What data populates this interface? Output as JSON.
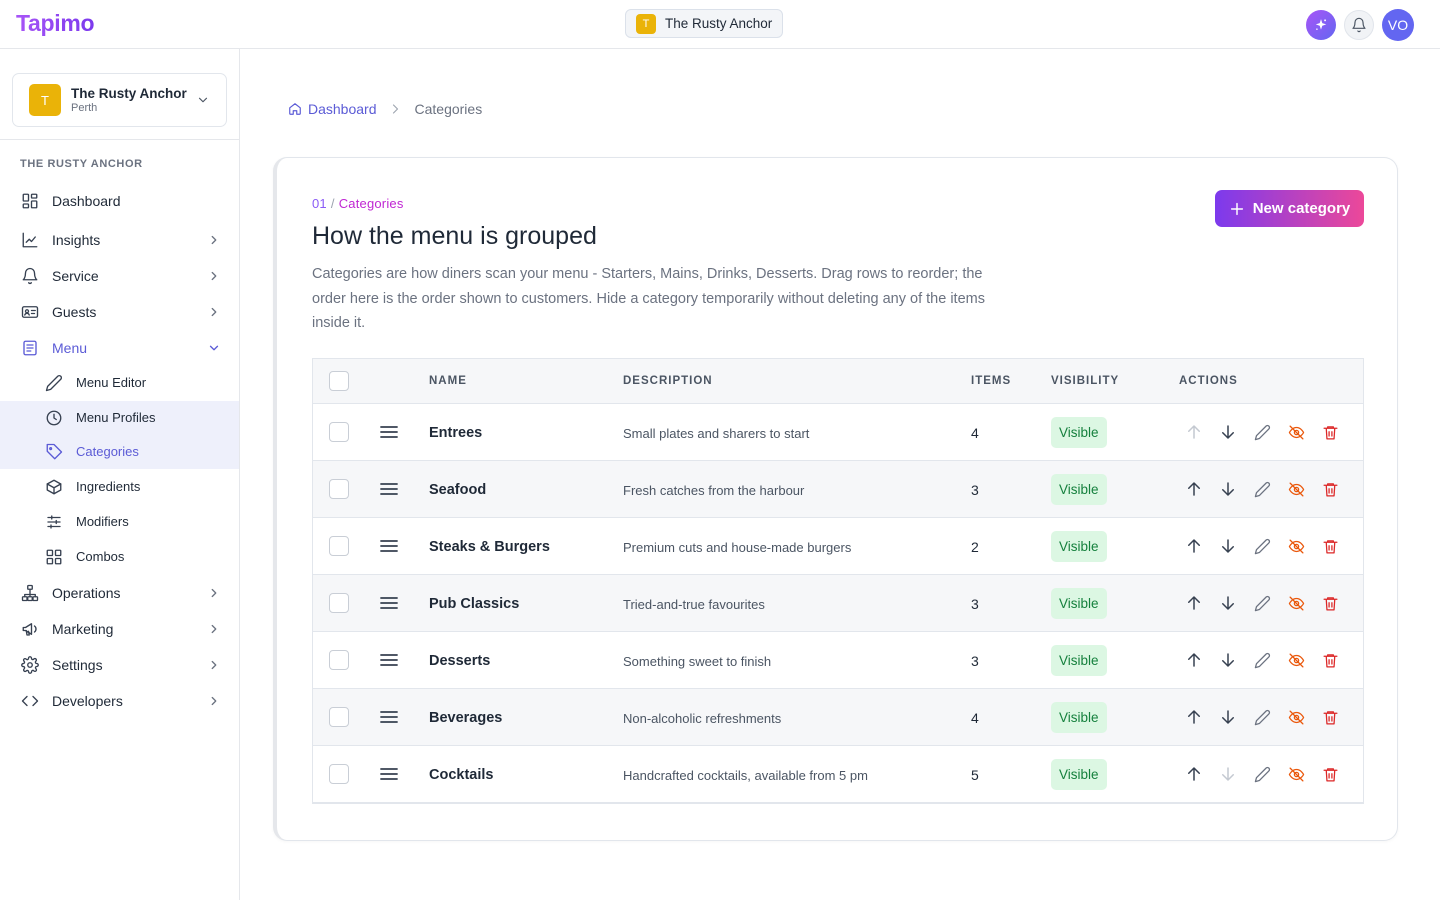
{
  "brand": {
    "logo_text": "Tapimo"
  },
  "topbar": {
    "venue_initial": "T",
    "venue_name": "The Rusty Anchor",
    "avatar_initials": "VO"
  },
  "sidebar": {
    "venue_initial": "T",
    "venue_name": "The Rusty Anchor",
    "venue_city": "Perth",
    "section_title": "THE RUSTY ANCHOR",
    "items": [
      {
        "label": "Dashboard",
        "icon": "grid-icon"
      },
      {
        "label": "Insights",
        "icon": "chart-icon"
      },
      {
        "label": "Service",
        "icon": "bell-icon"
      },
      {
        "label": "Guests",
        "icon": "id-card-icon"
      },
      {
        "label": "Menu",
        "icon": "book-icon"
      },
      {
        "label": "Operations",
        "icon": "org-icon"
      },
      {
        "label": "Marketing",
        "icon": "megaphone-icon"
      },
      {
        "label": "Settings",
        "icon": "gear-icon"
      },
      {
        "label": "Developers",
        "icon": "code-icon"
      }
    ],
    "menu_sub": [
      {
        "label": "Menu Editor",
        "icon": "pencil-icon"
      },
      {
        "label": "Menu Profiles",
        "icon": "clock-icon"
      },
      {
        "label": "Categories",
        "icon": "tag-icon"
      },
      {
        "label": "Ingredients",
        "icon": "box-icon"
      },
      {
        "label": "Modifiers",
        "icon": "sliders-icon"
      },
      {
        "label": "Combos",
        "icon": "grid-icon"
      }
    ]
  },
  "breadcrumb": {
    "home": "Dashboard",
    "current": "Categories"
  },
  "page": {
    "eyebrow_num": "01",
    "eyebrow_sep": "/",
    "eyebrow_word": "Categories",
    "title": "How the menu is grouped",
    "description": "Categories are how diners scan your menu - Starters, Mains, Drinks, Desserts. Drag rows to reorder; the order here is the order shown to customers. Hide a category temporarily without deleting any of the items inside it.",
    "new_button": "New category"
  },
  "table": {
    "columns": {
      "name": "NAME",
      "description": "DESCRIPTION",
      "items": "ITEMS",
      "visibility": "VISIBILITY",
      "actions": "ACTIONS"
    },
    "rows": [
      {
        "name": "Entrees",
        "description": "Small plates and sharers to start",
        "items": "4",
        "visibility": "Visible"
      },
      {
        "name": "Seafood",
        "description": "Fresh catches from the harbour",
        "items": "3",
        "visibility": "Visible"
      },
      {
        "name": "Steaks & Burgers",
        "description": "Premium cuts and house-made burgers",
        "items": "2",
        "visibility": "Visible"
      },
      {
        "name": "Pub Classics",
        "description": "Tried-and-true favourites",
        "items": "3",
        "visibility": "Visible"
      },
      {
        "name": "Desserts",
        "description": "Something sweet to finish",
        "items": "3",
        "visibility": "Visible"
      },
      {
        "name": "Beverages",
        "description": "Non-alcoholic refreshments",
        "items": "4",
        "visibility": "Visible"
      },
      {
        "name": "Cocktails",
        "description": "Handcrafted cocktails, available from 5 pm",
        "items": "5",
        "visibility": "Visible"
      }
    ]
  },
  "colors": {
    "accent": "#5b5bd6",
    "visible_badge_bg": "#dcf7e3",
    "visible_badge_text": "#15803d",
    "danger": "#dc2626",
    "warning": "#ea580c"
  }
}
